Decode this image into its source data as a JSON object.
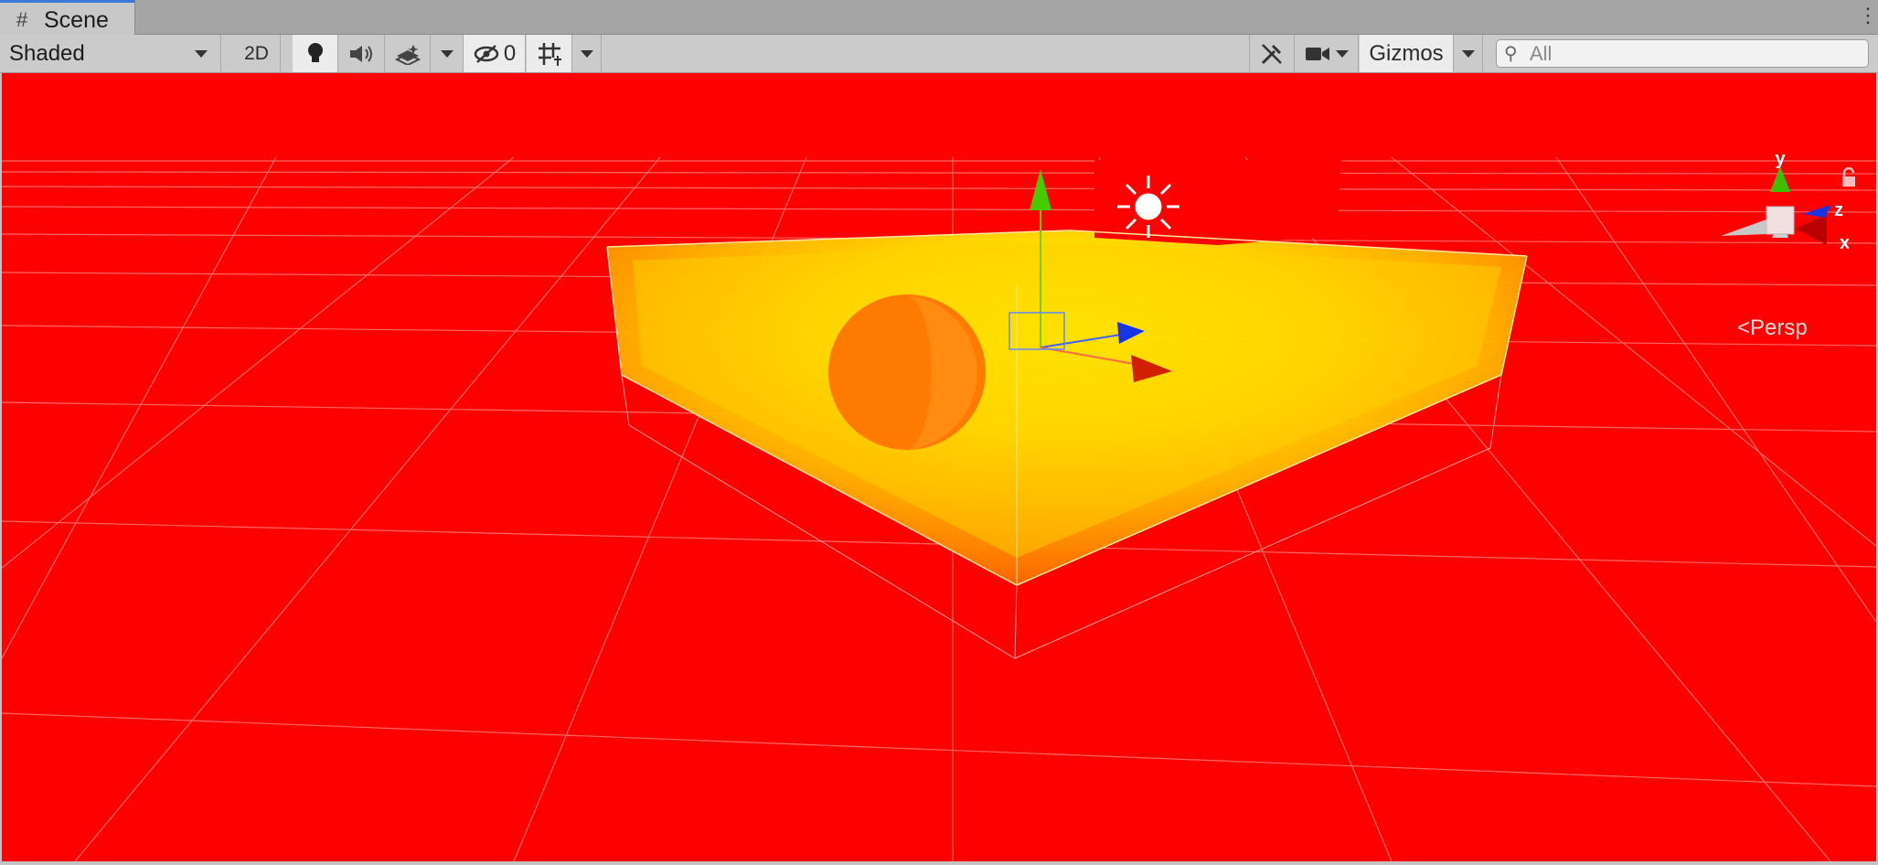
{
  "tab": {
    "title": "Scene",
    "icon": "grid-hash-icon"
  },
  "toolbar": {
    "shading_mode": "Shaded",
    "mode_2d": "2D",
    "hidden_count": "0",
    "gizmos": "Gizmos",
    "search_placeholder": "All"
  },
  "viewport": {
    "background_color": "#ff0000",
    "projection": "Persp",
    "axes": {
      "y": "y",
      "z": "z",
      "x": "x"
    }
  },
  "colors": {
    "axis_y": "#3dbf00",
    "axis_z": "#1636e6",
    "axis_x": "#d11f00",
    "volume_inner": "#ffee00",
    "volume_outer": "#ff5a00"
  }
}
